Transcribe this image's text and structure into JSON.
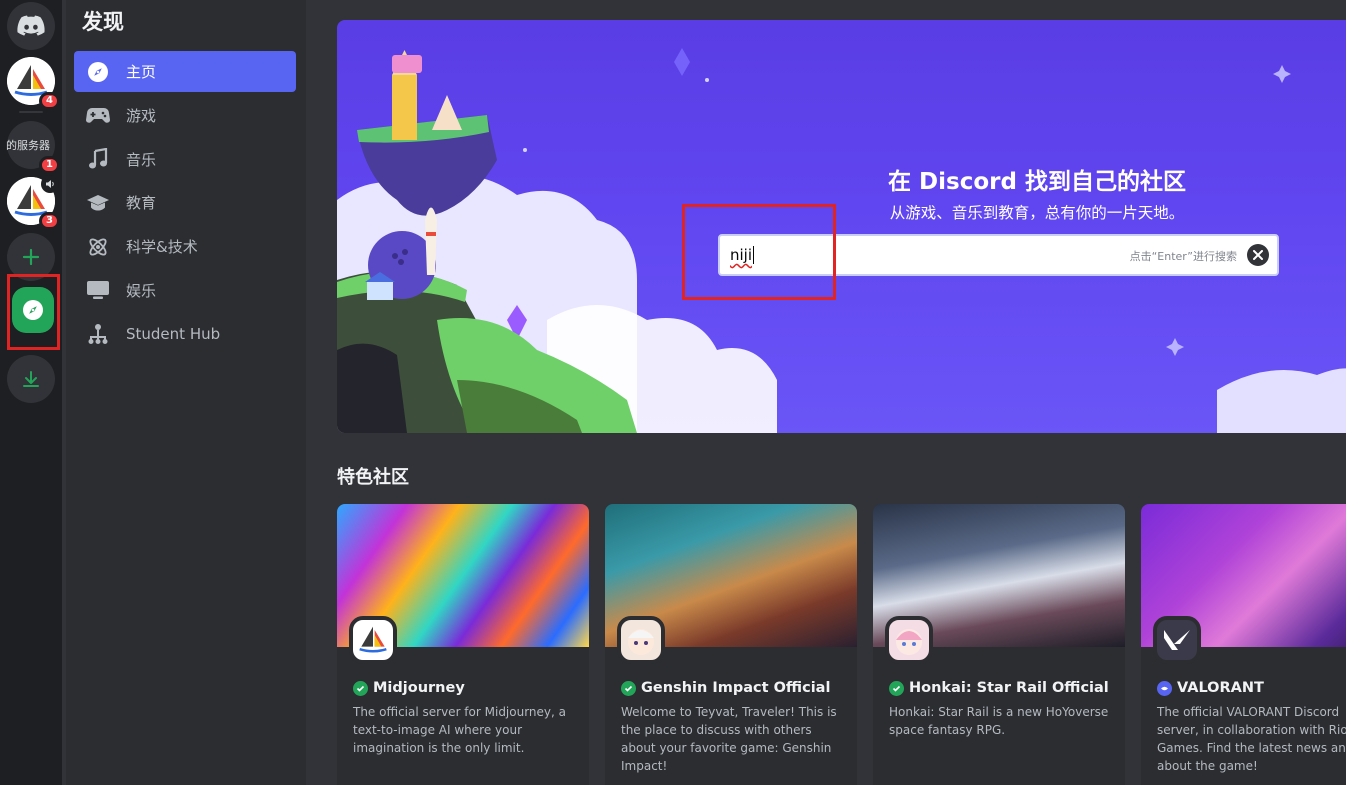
{
  "rail": {
    "server_text_label": "的服务器",
    "badges": {
      "server1": "4",
      "server2": "1",
      "server3": "3"
    },
    "icons": {
      "home": "discord-logo-icon",
      "speaker": "speaker-icon",
      "add": "plus-icon",
      "discover": "compass-icon",
      "download": "download-icon"
    }
  },
  "sidebar": {
    "title": "发现",
    "items": [
      {
        "label": "主页",
        "icon": "compass-icon",
        "active": true
      },
      {
        "label": "游戏",
        "icon": "gamepad-icon"
      },
      {
        "label": "音乐",
        "icon": "music-note-icon"
      },
      {
        "label": "教育",
        "icon": "graduation-cap-icon"
      },
      {
        "label": "科学&技术",
        "icon": "atom-icon"
      },
      {
        "label": "娱乐",
        "icon": "tv-icon"
      },
      {
        "label": "Student Hub",
        "icon": "hierarchy-icon"
      }
    ]
  },
  "hero": {
    "title": "在 Discord 找到自己的社区",
    "subtitle": "从游戏、音乐到教育，总有你的一片天地。",
    "search": {
      "value": "niji",
      "hint": "点击“Enter”进行搜索"
    }
  },
  "featured": {
    "title": "特色社区",
    "cards": [
      {
        "name": "Midjourney",
        "description": "The official server for Midjourney, a text-to-image AI where your imagination is the only limit.",
        "badge": "verified"
      },
      {
        "name": "Genshin Impact Official",
        "description": "Welcome to Teyvat, Traveler! This is the place to discuss with others about your favorite game: Genshin Impact!",
        "badge": "verified"
      },
      {
        "name": "Honkai: Star Rail Official",
        "description": "Honkai: Star Rail is a new HoYoverse space fantasy RPG.",
        "badge": "verified"
      },
      {
        "name": "VALORANT",
        "description": "The official VALORANT Discord server, in collaboration with Riot Games. Find the latest news and about the game!",
        "badge": "partnered"
      }
    ]
  },
  "colors": {
    "accent": "#5865f2",
    "green": "#23a559",
    "badge_red": "#f23f43",
    "highlight_red": "#e02323"
  }
}
